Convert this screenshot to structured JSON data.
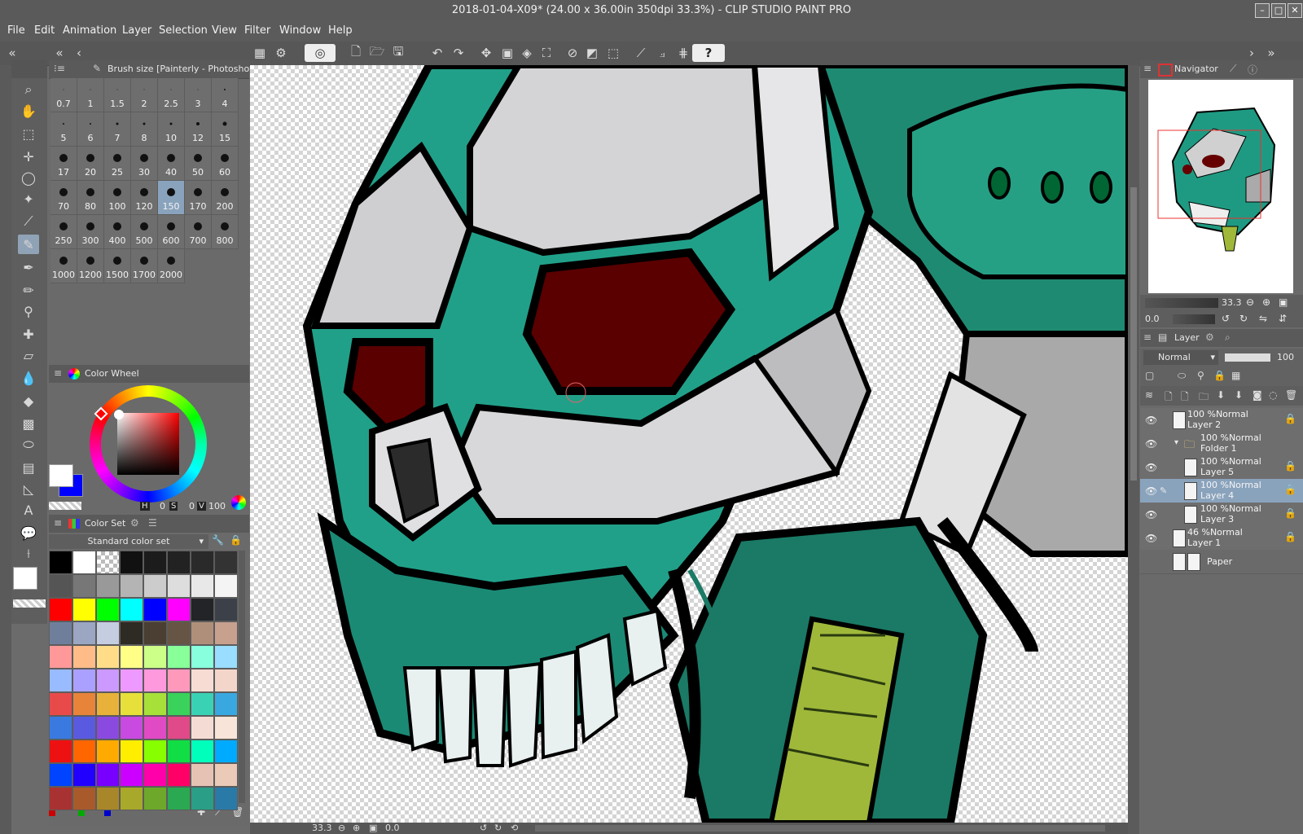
{
  "window": {
    "title": "2018-01-04-X09* (24.00 x 36.00in 350dpi 33.3%)  - CLIP STUDIO PAINT PRO"
  },
  "menu": [
    "File",
    "Edit",
    "Animation",
    "Layer",
    "Selection",
    "View",
    "Filter",
    "Window",
    "Help"
  ],
  "brush_panel": {
    "title": "Brush size [Painterly - Photoshop Rou",
    "sizes": [
      "0.7",
      "1",
      "1.5",
      "2",
      "2.5",
      "3",
      "4",
      "5",
      "6",
      "7",
      "8",
      "10",
      "12",
      "15",
      "17",
      "20",
      "25",
      "30",
      "40",
      "50",
      "60",
      "70",
      "80",
      "100",
      "120",
      "150",
      "170",
      "200",
      "250",
      "300",
      "400",
      "500",
      "600",
      "700",
      "800",
      "1000",
      "1200",
      "1500",
      "1700",
      "2000"
    ],
    "selected": "150"
  },
  "color_wheel": {
    "title": "Color Wheel",
    "h_label": "H",
    "h_value": "0",
    "s_label": "S",
    "s_value": "0",
    "v_label": "V",
    "v_value": "100"
  },
  "color_set": {
    "title": "Color Set",
    "set_name": "Standard color set",
    "swatches": [
      "#000000",
      "#ffffff",
      "checker",
      "#111111",
      "#1c1c1c",
      "#222222",
      "#2a2a2a",
      "#333333",
      "#555555",
      "#777777",
      "#999999",
      "#b4b4b4",
      "#cccccc",
      "#dddddd",
      "#e8e8e8",
      "#f4f4f4",
      "#ff0000",
      "#ffff00",
      "#00ff00",
      "#00ffff",
      "#0000ff",
      "#ff00ff",
      "#222428",
      "#3c4048",
      "#6f7f9b",
      "#9aa6c2",
      "#c5cde0",
      "#2e2a24",
      "#4a3f32",
      "#665544",
      "#b08f7a",
      "#c7a18e",
      "#ff9999",
      "#ffbb88",
      "#ffdd88",
      "#ffff88",
      "#ccff88",
      "#88ff99",
      "#88ffdd",
      "#99ddff",
      "#99bbff",
      "#aaa0ff",
      "#cc99ff",
      "#ee99ff",
      "#ff99dd",
      "#ff99bb",
      "#f7dcd3",
      "#f3d6c9",
      "#e84a4a",
      "#e8843a",
      "#e8b23a",
      "#e8e03a",
      "#a8e03a",
      "#3ad25a",
      "#3ad2b4",
      "#3aa8e0",
      "#3a7ae0",
      "#5a5ae0",
      "#8a4ae0",
      "#c84ae0",
      "#e04ac4",
      "#e04a88",
      "#f4dcd4",
      "#f8e4d8",
      "#ee1111",
      "#ff6600",
      "#ffaa00",
      "#ffee00",
      "#88ff00",
      "#11dd44",
      "#00ffbb",
      "#00aaff",
      "#0044ff",
      "#2200ff",
      "#7700ff",
      "#cc00ff",
      "#ff00aa",
      "#ff0066",
      "#e6c2b4",
      "#eccab8",
      "#a83232",
      "#a85a2a",
      "#a8862a",
      "#a8a82a",
      "#6ea82a",
      "#2aa852",
      "#2a9e86",
      "#2a7aa8"
    ]
  },
  "statusbar": {
    "zoom": "33.3",
    "rotation": "0.0"
  },
  "navigator": {
    "title": "Navigator",
    "zoom": "33.3",
    "rotation": "0.0"
  },
  "layer_panel": {
    "title": "Layer",
    "blend_mode": "Normal",
    "opacity": "100",
    "layers": [
      {
        "mode": "100 %Normal",
        "name": "Layer 2",
        "indent": 0,
        "selected": false
      },
      {
        "mode": "100 %Normal",
        "name": "Folder 1",
        "indent": 1,
        "selected": false
      },
      {
        "mode": "100 %Normal",
        "name": "Layer 5",
        "indent": 2,
        "selected": false
      },
      {
        "mode": "100 %Normal",
        "name": "Layer 4",
        "indent": 2,
        "selected": true
      },
      {
        "mode": "100 %Normal",
        "name": "Layer 3",
        "indent": 2,
        "selected": false
      },
      {
        "mode": "46 %Normal",
        "name": "Layer 1",
        "indent": 0,
        "selected": false
      }
    ],
    "paper": "Paper"
  }
}
